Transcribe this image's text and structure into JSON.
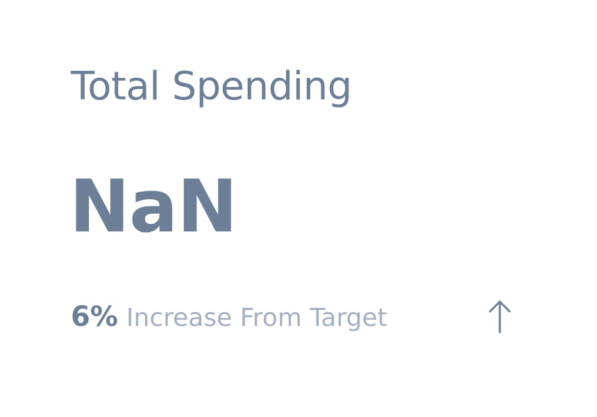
{
  "card": {
    "title": "Total Spending",
    "value": "NaN",
    "change_percent": "6%",
    "change_description": "Increase From Target",
    "trend_icon": "arrow-up-icon",
    "colors": {
      "primary_text": "#6d7f97",
      "muted_text": "#a4b0c2",
      "background": "#ffffff"
    }
  }
}
